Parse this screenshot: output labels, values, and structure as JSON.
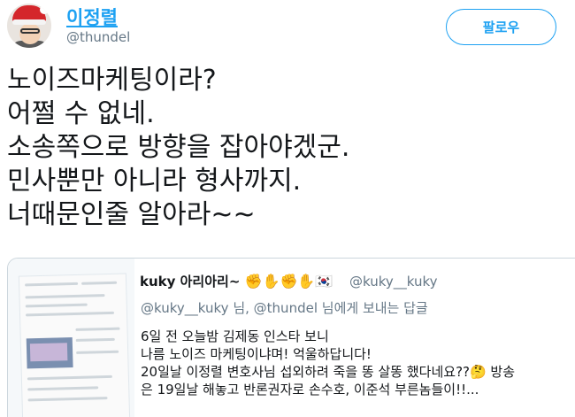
{
  "author": {
    "display_name": "이정렬",
    "handle": "@thundel",
    "avatar": "santa-hat-avatar"
  },
  "follow_button": {
    "label": "팔로우",
    "color": "#1da1f2"
  },
  "tweet": {
    "lines": [
      "노이즈마케팅이라?",
      "어쩔 수 없네.",
      "소송쪽으로 방향을 잡아야겠군.",
      "민사뿐만 아니라 형사까지.",
      "너때문인줄 알아라~~"
    ]
  },
  "quoted_tweet": {
    "display_name": "kuky 아리아리~",
    "name_emojis": "✊✋✊✋🇰🇷",
    "handle": "@kuky__kuky",
    "reply_line": {
      "to_handle": "@kuky__kuky",
      "middle": "님,",
      "recipient": "@thundel",
      "suffix": "님에게 보내는 답글"
    },
    "body_lines": [
      "6일 전 오늘밤 김제동 인스타 보니",
      "나름 노이즈 마케팅이냐며! 억울하답니다!",
      "20일날 이정렬 변호사님 섭외하려 죽을 똥 살똥 했다네요??🤔 방송",
      "은 19일날 해놓고 반론권자로 손수호, 이준석 부른놈들이!!..."
    ]
  }
}
